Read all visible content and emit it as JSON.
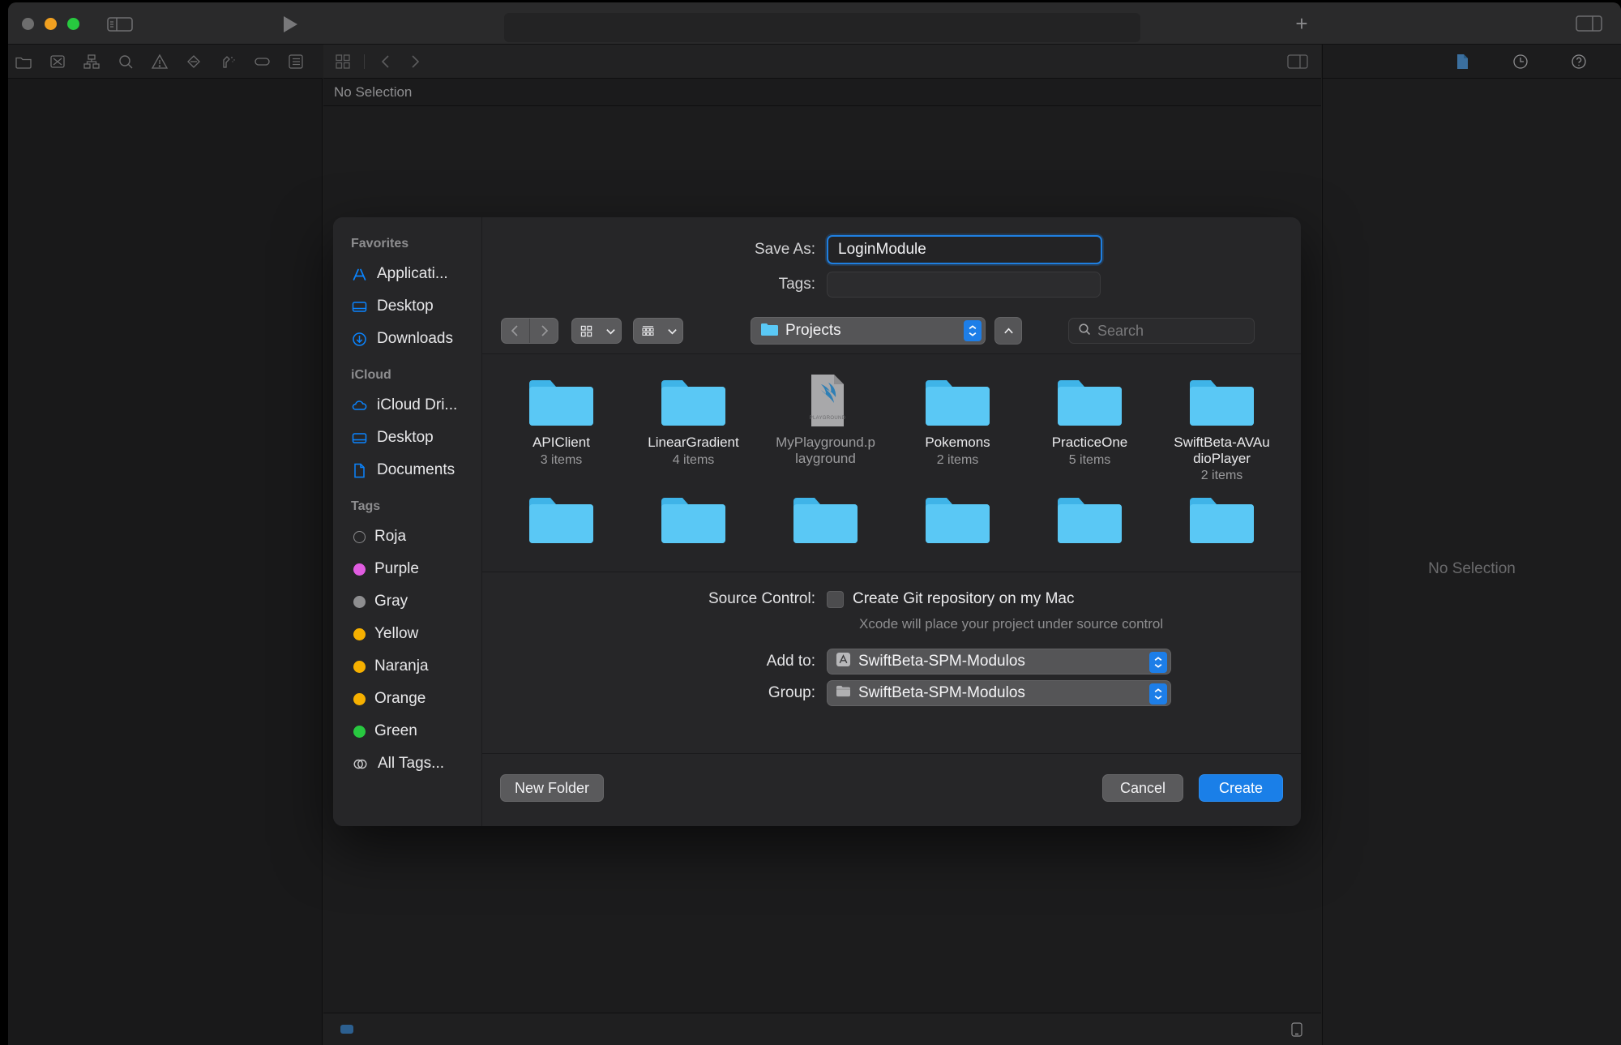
{
  "window": {
    "titlebar": {
      "traffic_lights": [
        "close",
        "minimize",
        "zoom"
      ],
      "sidebar_toggle": "sidebar-toggle-icon",
      "run": "run-icon",
      "add": "+",
      "inspector_toggle": "inspector-toggle-icon"
    },
    "navigator_toolbar_icons": [
      "folder-icon",
      "source-control-icon",
      "hierarchy-icon",
      "search-icon",
      "warning-icon",
      "breakpoint-icon",
      "report-icon",
      "tag-icon",
      "list-icon"
    ],
    "editor_toolbar_icons": [
      "grid-icon",
      "back-chevron-icon",
      "forward-chevron-icon"
    ],
    "jumpbar_label": "No Selection",
    "inspector": {
      "icons": [
        "file-inspector-icon",
        "history-inspector-icon",
        "quick-help-icon"
      ],
      "empty_label": "No Selection"
    }
  },
  "save_panel": {
    "sidebar": {
      "sections": [
        {
          "header": "Favorites",
          "items": [
            {
              "label": "Applicati...",
              "icon": "applications-icon"
            },
            {
              "label": "Desktop",
              "icon": "desktop-icon"
            },
            {
              "label": "Downloads",
              "icon": "downloads-icon"
            }
          ]
        },
        {
          "header": "iCloud",
          "items": [
            {
              "label": "iCloud Dri...",
              "icon": "icloud-icon"
            },
            {
              "label": "Desktop",
              "icon": "desktop-icon"
            },
            {
              "label": "Documents",
              "icon": "documents-icon"
            }
          ]
        },
        {
          "header": "Tags",
          "items": [
            {
              "label": "Roja",
              "icon": "tag-dot-icon",
              "color": "none"
            },
            {
              "label": "Purple",
              "icon": "tag-dot-icon",
              "color": "#e05ce0"
            },
            {
              "label": "Gray",
              "icon": "tag-dot-icon",
              "color": "#8e8e90"
            },
            {
              "label": "Yellow",
              "icon": "tag-dot-icon",
              "color": "#f6b000"
            },
            {
              "label": "Naranja",
              "icon": "tag-dot-icon",
              "color": "#f6b000"
            },
            {
              "label": "Orange",
              "icon": "tag-dot-icon",
              "color": "#f6b000"
            },
            {
              "label": "Green",
              "icon": "tag-dot-icon",
              "color": "#28c840"
            },
            {
              "label": "All Tags...",
              "icon": "all-tags-icon",
              "color": "none"
            }
          ]
        }
      ]
    },
    "save_as": {
      "label": "Save As:",
      "value": "LoginModule",
      "placeholder": ""
    },
    "tags": {
      "label": "Tags:",
      "value": "",
      "placeholder": ""
    },
    "browser_toolbar": {
      "back_icon": "back-chevron-icon",
      "forward_icon": "forward-chevron-icon",
      "view_mode_icon": "icon-view-icon",
      "group_mode_icon": "group-by-icon",
      "path_popup_label": "Projects",
      "up_icon": "up-chevron-icon",
      "search_placeholder": "Search"
    },
    "files": [
      {
        "name": "APIClient",
        "count": "3 items",
        "type": "folder"
      },
      {
        "name": "LinearGradient",
        "count": "4 items",
        "type": "folder"
      },
      {
        "name": "MyPlayground.playground",
        "count": "",
        "type": "playground"
      },
      {
        "name": "Pokemons",
        "count": "2 items",
        "type": "folder"
      },
      {
        "name": "PracticeOne",
        "count": "5 items",
        "type": "folder"
      },
      {
        "name": "SwiftBeta-AVAudioPlayer",
        "count": "2 items",
        "type": "folder"
      },
      {
        "name": "",
        "count": "",
        "type": "folder"
      },
      {
        "name": "",
        "count": "",
        "type": "folder"
      },
      {
        "name": "",
        "count": "",
        "type": "folder"
      },
      {
        "name": "",
        "count": "",
        "type": "folder"
      },
      {
        "name": "",
        "count": "",
        "type": "folder"
      },
      {
        "name": "",
        "count": "",
        "type": "folder"
      }
    ],
    "source_control": {
      "label": "Source Control:",
      "checkbox_label": "Create Git repository on my Mac",
      "checked": false,
      "hint": "Xcode will place your project under source control"
    },
    "add_to": {
      "label": "Add to:",
      "value": "SwiftBeta-SPM-Modulos",
      "icon": "xcode-project-icon"
    },
    "group": {
      "label": "Group:",
      "value": "SwiftBeta-SPM-Modulos",
      "icon": "group-folder-icon"
    },
    "footer": {
      "new_folder": "New Folder",
      "cancel": "Cancel",
      "create": "Create"
    }
  },
  "colors": {
    "accent": "#1a7fe8",
    "folder_blue": "#57c5f7",
    "panel_bg": "#262628",
    "window_bg": "#1e1e1e"
  }
}
